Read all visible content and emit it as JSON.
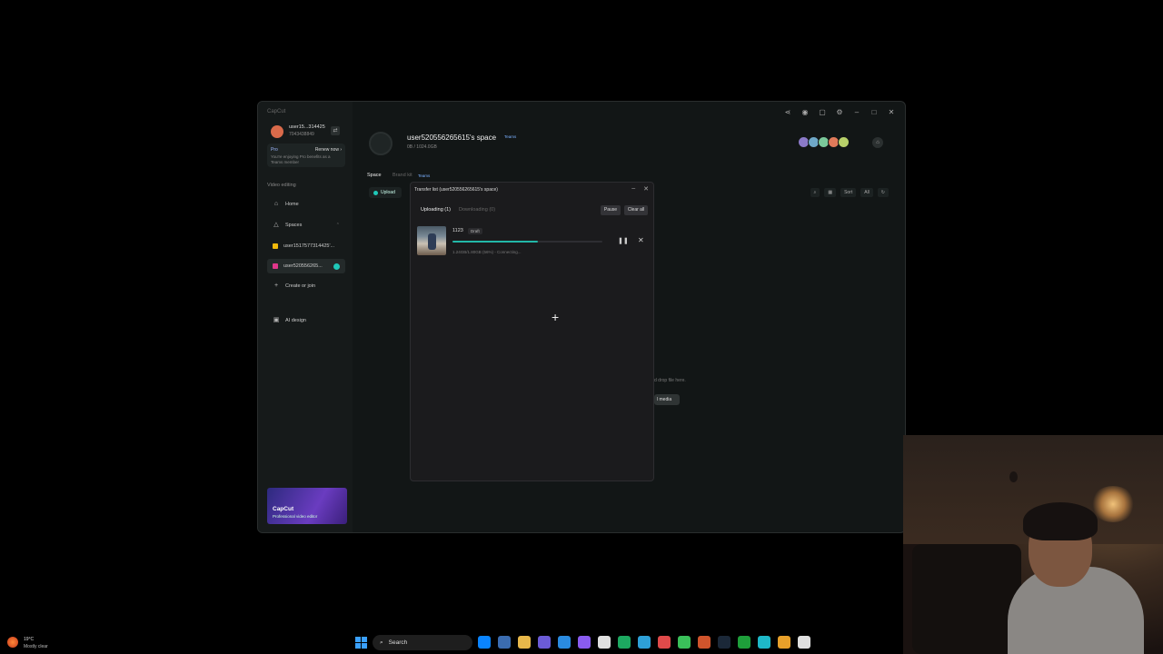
{
  "app": {
    "title": "CapCut",
    "window_controls": [
      "share",
      "help",
      "feedback",
      "settings",
      "minimize",
      "maximize",
      "close"
    ]
  },
  "sidebar": {
    "user_name": "user15...314425",
    "user_id": "7043438849",
    "pro_label": "Pro",
    "renew_label": "Renew now ›",
    "pro_note": "You're enjoying Pro benefits as a Teams member",
    "section_label": "Video editing",
    "items": [
      {
        "label": "Home",
        "icon": "home-icon"
      },
      {
        "label": "Spaces",
        "icon": "spaces-icon"
      },
      {
        "label": "user1517577314425'...",
        "icon": "yellow-square",
        "color": "#f0b90b"
      },
      {
        "label": "user520556265...",
        "icon": "pink-square",
        "color": "#e0368a"
      },
      {
        "label": "Create or join",
        "icon": "plus-icon"
      },
      {
        "label": "AI design",
        "icon": "ai-design-icon"
      }
    ],
    "promo": {
      "title": "CapCut",
      "subtitle": "Professional video editor"
    }
  },
  "header": {
    "space_title": "user520556265615's space",
    "teams_badge": "Teams",
    "space_size": "0B / 1024.0GB",
    "member_colors": [
      "#8b7ac8",
      "#6fa8c8",
      "#7ac89a",
      "#e07a5a",
      "#b8d06a"
    ]
  },
  "tabs": [
    {
      "label": "Space"
    },
    {
      "label": "Brand kit"
    },
    {
      "label": "Teams"
    }
  ],
  "toolbar": {
    "upload_label": "Upload",
    "sort_label": "Sort",
    "filter_label": "All"
  },
  "empty_state": {
    "drop_text": "d drop file here.",
    "add_media_label": "l media"
  },
  "transfer_dialog": {
    "title": "Transfer list (user520556265615's space)",
    "tab_uploading": "Uploading (1)",
    "tab_downloading": "Downloading (0)",
    "pause_all_label": "Pause",
    "clear_all_label": "Clear all",
    "item": {
      "name": "1123",
      "badge": "Draft",
      "progress": 0.57,
      "status": "1.24GB/1.80GB (56%) - Connecting..."
    }
  },
  "taskbar": {
    "weather_temp": "19°C",
    "weather_desc": "Mostly clear",
    "search_placeholder": "Search",
    "apps": [
      "#0a84ff",
      "#3b6cb0",
      "#e8b84a",
      "#6b5bd6",
      "#2a8be0",
      "#8a5cf0",
      "#e0e0e0",
      "#1da860",
      "#2ea0d8",
      "#e04a4a",
      "#3ac05a",
      "#d0542c",
      "#1b2838",
      "#1e9e3a",
      "#1eb8c8",
      "#e8a02a",
      "#e0e0e0"
    ]
  }
}
